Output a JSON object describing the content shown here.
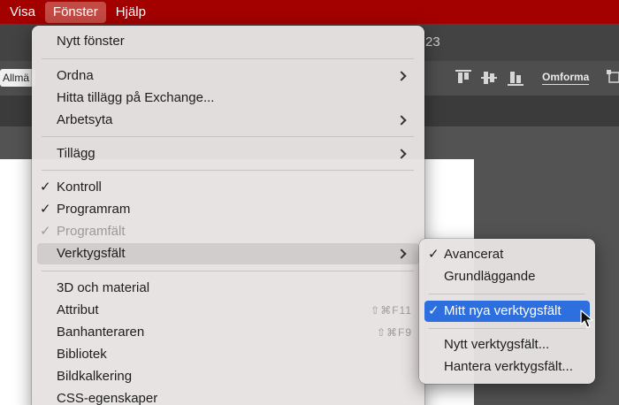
{
  "menubar": {
    "items": [
      {
        "label": "Visa",
        "active": false
      },
      {
        "label": "Fönster",
        "active": true
      },
      {
        "label": "Hjälp",
        "active": false
      }
    ]
  },
  "app": {
    "title_fragment": "23",
    "control_dropdown": "Allmä",
    "reshape_label": "Omforma"
  },
  "window_menu": {
    "items": {
      "new_window": "Nytt fönster",
      "arrange": "Ordna",
      "find_exchange": "Hitta tillägg på Exchange...",
      "workspace": "Arbetsyta",
      "extensions": "Tillägg",
      "control": "Kontroll",
      "app_frame": "Programram",
      "app_bar": "Programfält",
      "toolbars": "Verktygsfält",
      "material_3d": "3D och material",
      "attributes": "Attribut",
      "path_manager": "Banhanteraren",
      "libraries": "Bibliotek",
      "image_trace": "Bildkalkering",
      "css_properties": "CSS-egenskaper"
    },
    "checkmark": "✓",
    "shortcuts": {
      "attributes": "⇧⌘F11",
      "path_manager": "⇧⌘F9"
    }
  },
  "toolbars_submenu": {
    "items": {
      "advanced": "Avancerat",
      "basic": "Grundläggande",
      "my_new_toolbar": "Mitt nya verktygsfält",
      "new_toolbar": "Nytt verktygsfält...",
      "manage_toolbars": "Hantera verktygsfält..."
    },
    "checkmark": "✓"
  },
  "colors": {
    "menubar": "#a30000",
    "menubar_active": "#c44a44",
    "selection": "#2d6fde",
    "menu_bg": "#e7e2e2"
  }
}
